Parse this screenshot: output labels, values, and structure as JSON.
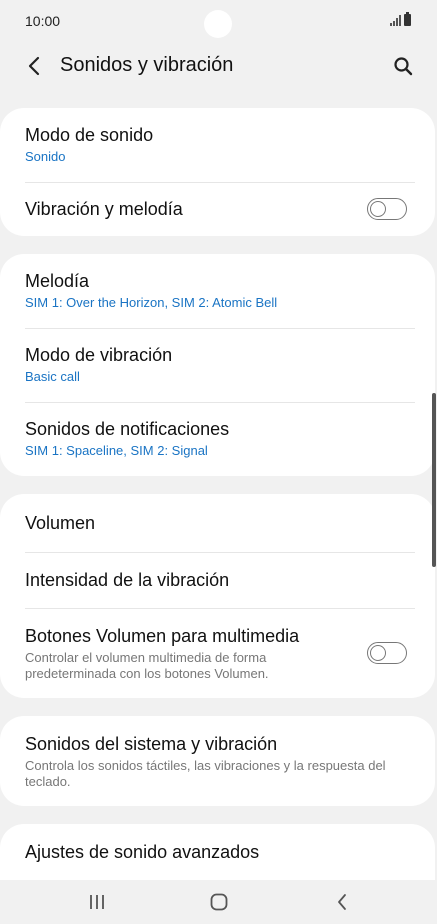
{
  "status": {
    "time": "10:00"
  },
  "header": {
    "title": "Sonidos y vibración",
    "back_icon": "chevron-left-icon",
    "search_icon": "search-icon"
  },
  "group1": [
    {
      "title": "Modo de sonido",
      "subtitle": "Sonido"
    },
    {
      "title": "Vibración y melodía",
      "toggle": false
    }
  ],
  "group2": [
    {
      "title": "Melodía",
      "subtitle": "SIM 1: Over the Horizon, SIM 2: Atomic Bell"
    },
    {
      "title": "Modo de vibración",
      "subtitle": "Basic call"
    },
    {
      "title": "Sonidos de notificaciones",
      "subtitle": "SIM 1: Spaceline, SIM 2: Signal"
    }
  ],
  "group3": [
    {
      "title": "Volumen"
    },
    {
      "title": "Intensidad de la vibración"
    },
    {
      "title": "Botones Volumen para multimedia",
      "description": "Controlar el volumen multimedia de forma predeterminada con los botones Volumen.",
      "toggle": false
    }
  ],
  "group4": [
    {
      "title": "Sonidos del sistema y vibración",
      "description": "Controla los sonidos táctiles, las vibraciones y la respuesta del teclado."
    }
  ],
  "group5": [
    {
      "title": "Ajustes de sonido avanzados"
    }
  ],
  "colors": {
    "accent": "#1a74c4",
    "background": "#f1f1f1",
    "card": "#ffffff"
  }
}
